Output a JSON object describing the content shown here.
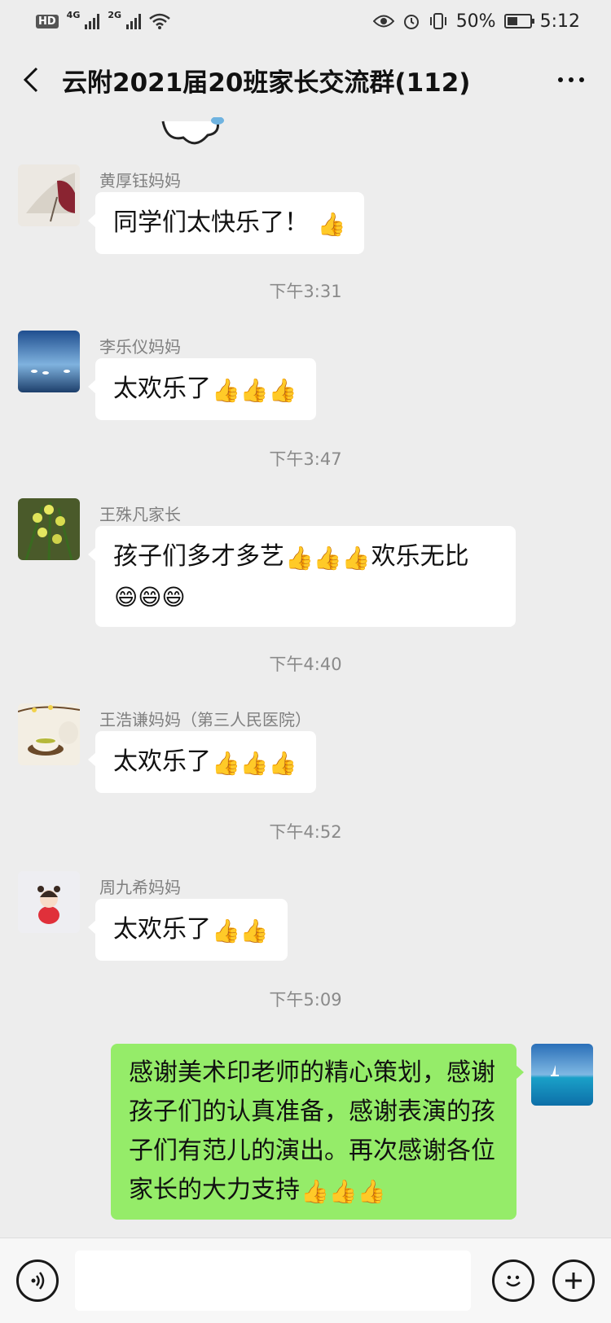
{
  "status_bar": {
    "hd": "HD",
    "net1": "4G",
    "net2": "2G",
    "battery_pct": "50%",
    "time": "5:12"
  },
  "header": {
    "title": "云附2021届20班家长交流群(112)"
  },
  "messages": [
    {
      "sender": "黄厚钰妈妈",
      "text": "同学们太快乐了！",
      "emoji": "👍"
    },
    {
      "time": "下午3:31"
    },
    {
      "sender": "李乐仪妈妈",
      "text": "太欢乐了",
      "emoji": "👍👍👍"
    },
    {
      "time": "下午3:47"
    },
    {
      "sender": "王殊凡家长",
      "text": "孩子们多才多艺",
      "emoji": "👍👍👍",
      "text2": "欢乐无比",
      "emoji2": "😄😄😄"
    },
    {
      "time": "下午4:40"
    },
    {
      "sender": "王浩谦妈妈（第三人民医院）",
      "text": "太欢乐了",
      "emoji": "👍👍👍"
    },
    {
      "time": "下午4:52"
    },
    {
      "sender": "周九希妈妈",
      "text": "太欢乐了",
      "emoji": "👍👍"
    },
    {
      "time": "下午5:09"
    },
    {
      "sender": "me",
      "text": "感谢美术印老师的精心策划，感谢孩子们的认真准备，感谢表演的孩子们有范儿的演出。再次感谢各位家长的大力支持",
      "emoji": "👍👍👍"
    }
  ],
  "colors": {
    "background": "#ededed",
    "my_bubble": "#95ec69",
    "other_bubble": "#ffffff"
  },
  "input": {
    "value": "",
    "placeholder": ""
  }
}
